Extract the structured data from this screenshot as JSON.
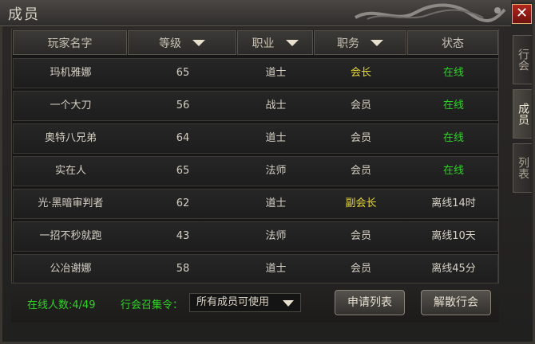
{
  "window": {
    "title": "成员",
    "close_label": "✕"
  },
  "side_tabs": [
    {
      "label": "行会",
      "active": false
    },
    {
      "label": "成员",
      "active": true
    },
    {
      "label": "列表",
      "active": false
    }
  ],
  "table": {
    "columns": [
      "玩家名字",
      "等级",
      "职业",
      "职务",
      "状态"
    ],
    "sortable": [
      false,
      true,
      true,
      true,
      false
    ],
    "rows": [
      {
        "name": "玛机雅娜",
        "level": "65",
        "class": "道士",
        "role": "会长",
        "status": "在线"
      },
      {
        "name": "一个大刀",
        "level": "56",
        "class": "战士",
        "role": "会员",
        "status": "在线"
      },
      {
        "name": "奥特八兄弟",
        "level": "64",
        "class": "道士",
        "role": "会员",
        "status": "在线"
      },
      {
        "name": "实在人",
        "level": "65",
        "class": "法师",
        "role": "会员",
        "status": "在线"
      },
      {
        "name": "光·黑暗审判者",
        "level": "62",
        "class": "道士",
        "role": "副会长",
        "status": "离线14时"
      },
      {
        "name": "一招不秒就跑",
        "level": "43",
        "class": "法师",
        "role": "会员",
        "status": "离线10天"
      },
      {
        "name": "公冶谢娜",
        "level": "58",
        "class": "道士",
        "role": "会员",
        "status": "离线45分"
      }
    ]
  },
  "footer": {
    "online_count": "在线人数:4/49",
    "summon_label": "行会召集令：",
    "summon_select": "所有成员可使用",
    "apply_list_button": "申请列表",
    "disband_button": "解散行会"
  },
  "colors": {
    "online": "#2fd326",
    "leader": "#e7d83a",
    "normal": "#d6d0c4"
  }
}
